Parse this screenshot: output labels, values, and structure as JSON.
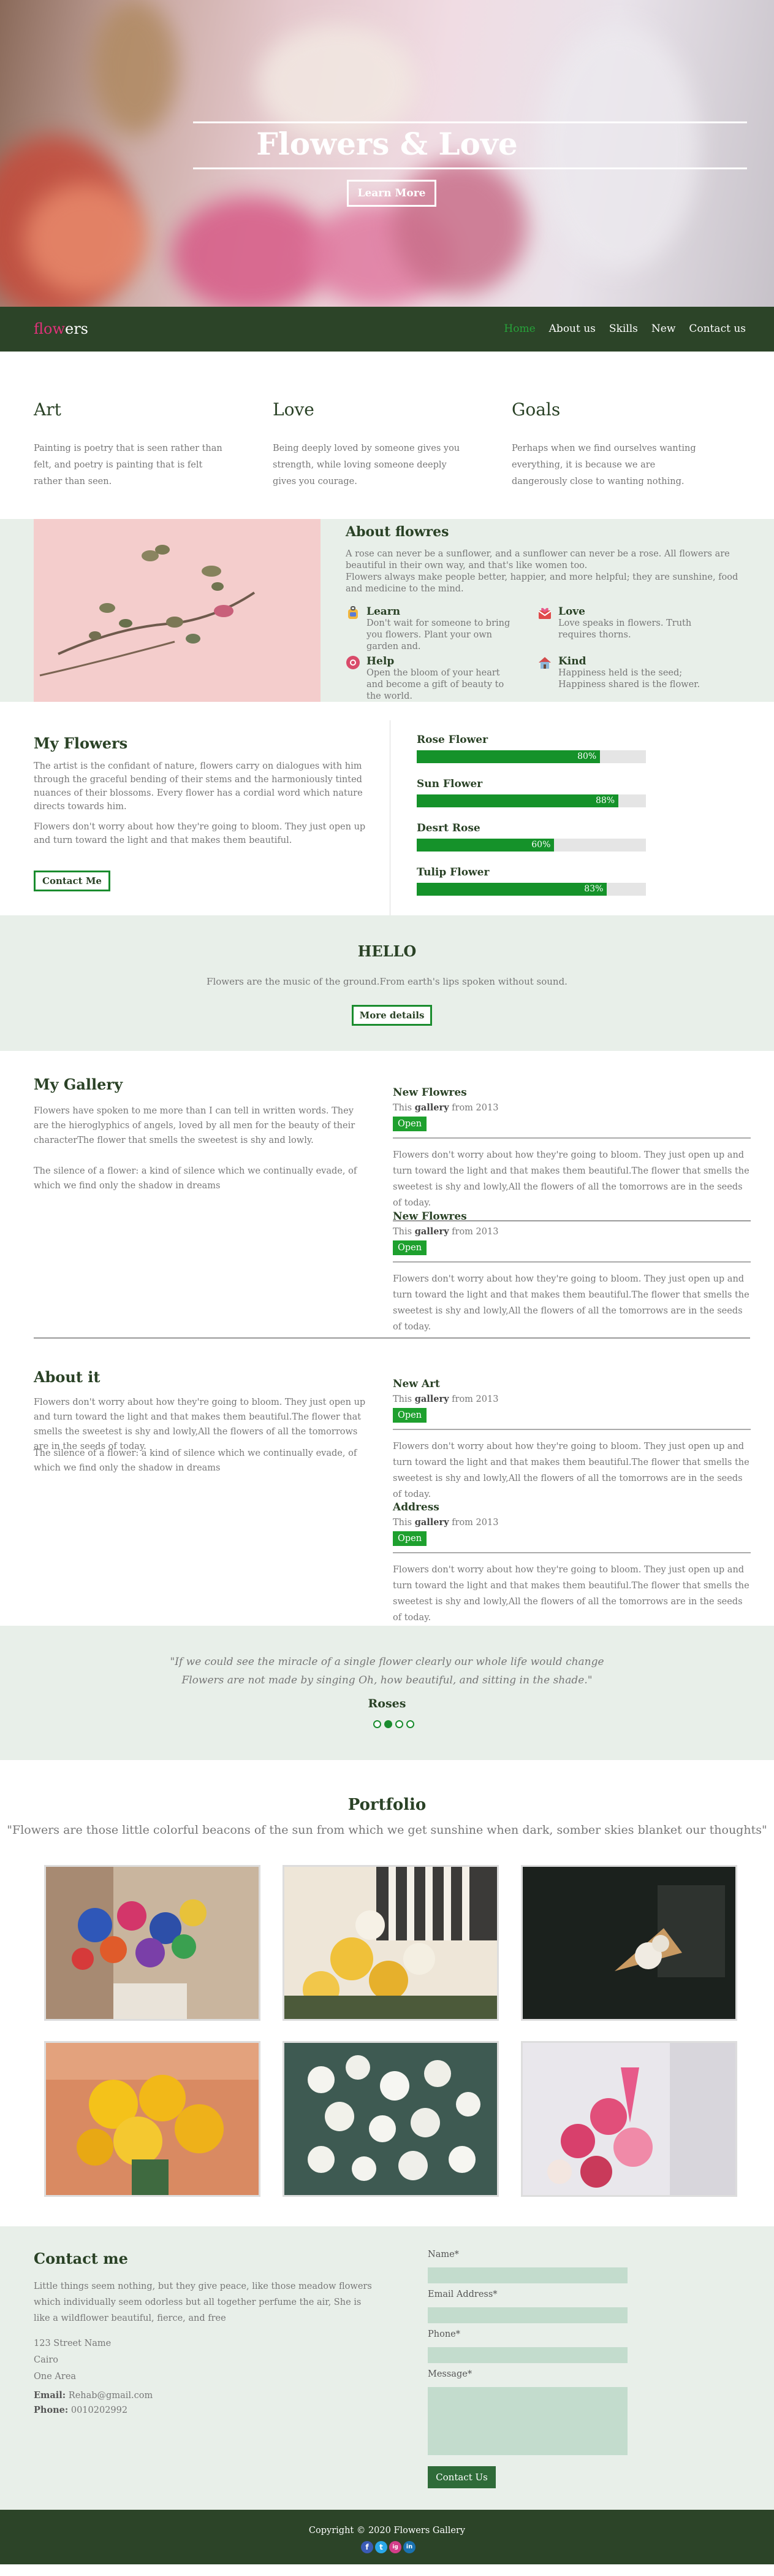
{
  "hero": {
    "title": "Flowers & Love",
    "button": "Learn More"
  },
  "nav": {
    "logo_accent": "flow",
    "logo_rest": "ers",
    "items": [
      "Home",
      "About us",
      "Skills",
      "New",
      "Contact us"
    ]
  },
  "columns": [
    {
      "title": "Art",
      "text": "Painting is poetry that is seen rather than felt, and poetry is painting that is felt rather than seen."
    },
    {
      "title": "Love",
      "text": "Being deeply loved by someone gives you strength, while loving someone deeply gives you courage."
    },
    {
      "title": "Goals",
      "text": "Perhaps when we find ourselves wanting everything, it is because we are dangerously close to wanting nothing."
    }
  ],
  "about": {
    "title": "About flowres",
    "text1": "A rose can never be a sunflower, and a sunflower can never be a rose. All flowers are beautiful in their own way, and that's like women too.",
    "text2": "Flowers always make people better, happier, and more helpful; they are sunshine, food and medicine to the mind.",
    "features": [
      {
        "title": "Learn",
        "text": "Don't wait for someone to bring you flowers. Plant your own garden and.",
        "icon": "backpack-icon"
      },
      {
        "title": "Love",
        "text": "Love speaks in flowers. Truth requires thorns.",
        "icon": "heart-mail-icon"
      },
      {
        "title": "Help",
        "text": "Open the bloom of your heart and become a gift of beauty to the world.",
        "icon": "help-icon"
      },
      {
        "title": "Kind",
        "text": "Happiness held is the seed; Happiness shared is the flower.",
        "icon": "house-icon"
      }
    ]
  },
  "skills": {
    "title": "My Flowers",
    "p1": "The artist is the confidant of nature, flowers carry on dialogues with him through the graceful bending of their stems and the harmoniously tinted nuances of their blossoms. Every flower has a cordial word which nature directs towards him.",
    "p2": "Flowers don't worry about how they're going to bloom. They just open up and turn toward the light and that makes them beautiful.",
    "button": "Contact Me",
    "bars": [
      {
        "name": "Rose Flower",
        "value": 80,
        "label": "80%"
      },
      {
        "name": "Sun Flower",
        "value": 88,
        "label": "88%"
      },
      {
        "name": "Desrt Rose",
        "value": 60,
        "label": "60%"
      },
      {
        "name": "Tulip Flower",
        "value": 83,
        "label": "83%"
      }
    ]
  },
  "hello": {
    "title": "HELLO",
    "text": "Flowers are the music of the ground.From earth's lips spoken without sound.",
    "button": "More details"
  },
  "gallery": {
    "title": "My Gallery",
    "p1": "Flowers have spoken to me more than I can tell in written words. They are the hieroglyphics of angels, loved by all men for the beauty of their characterThe flower that smells the sweetest is shy and lowly.",
    "p2": "The silence of a flower: a kind of silence which we continually evade, of which we find only the shadow in dreams",
    "items": [
      {
        "title": "New Flowres",
        "sub_pre": "This ",
        "sub_bold": "gallery",
        "sub_post": " from 2013",
        "button": "Open",
        "text": "Flowers don't worry about how they're going to bloom. They just open up and turn toward the light and that makes them beautiful.The flower that smells the sweetest is shy and lowly,All the flowers of all the tomorrows are in the seeds of today."
      },
      {
        "title": "New Flowres",
        "sub_pre": "This ",
        "sub_bold": "gallery",
        "sub_post": " from 2013",
        "button": "Open",
        "text": "Flowers don't worry about how they're going to bloom. They just open up and turn toward the light and that makes them beautiful.The flower that smells the sweetest is shy and lowly,All the flowers of all the tomorrows are in the seeds of today."
      }
    ]
  },
  "aboutit": {
    "title": "About it",
    "p1": "Flowers don't worry about how they're going to bloom. They just open up and turn toward the light and that makes them beautiful.The flower that smells the sweetest is shy and lowly,All the flowers of all the tomorrows are in the seeds of today.",
    "p2": "The silence of a flower: a kind of silence which we continually evade, of which we find only the shadow in dreams",
    "items": [
      {
        "title": "New Art",
        "sub_pre": "This ",
        "sub_bold": "gallery",
        "sub_post": " from 2013",
        "button": "Open",
        "text": "Flowers don't worry about how they're going to bloom. They just open up and turn toward the light and that makes them beautiful.The flower that smells the sweetest is shy and lowly,All the flowers of all the tomorrows are in the seeds of today."
      },
      {
        "title": "Address",
        "sub_pre": "This ",
        "sub_bold": "gallery",
        "sub_post": " from 2013",
        "button": "Open",
        "text": "Flowers don't worry about how they're going to bloom. They just open up and turn toward the light and that makes them beautiful.The flower that smells the sweetest is shy and lowly,All the flowers of all the tomorrows are in the seeds of today."
      }
    ]
  },
  "quote": {
    "line1": "\"If we could see the miracle of a single flower clearly our whole life would change",
    "line2": "Flowers are not made by singing Oh, how beautiful, and sitting in the shade.\"",
    "author": "Roses",
    "active_dot": 1
  },
  "portfolio": {
    "title": "Portfolio",
    "quote": "\"Flowers are those little colorful beacons of the sun from which we get sunshine when dark, somber skies blanket our thoughts\""
  },
  "contact": {
    "title": "Contact me",
    "text": "Little things seem nothing, but they give peace, like those meadow flowers which individually seem odorless but all together perfume the air, She is like a wildflower beautiful, fierce, and free",
    "addr1": "123 Street Name",
    "addr2": "Cairo",
    "addr3": "One Area",
    "email_label": "Email:",
    "email": "Rehab@gmail.com",
    "phone_label": "Phone:",
    "phone": "0010202992",
    "form": {
      "name": "Name*",
      "email": "Email Address*",
      "phone": "Phone*",
      "message": "Message*",
      "button": "Contact Us"
    }
  },
  "footer": {
    "copyright": "Copyright © 2020 Flowers Gallery",
    "social": [
      "f",
      "t",
      "ig",
      "in"
    ]
  },
  "colors": {
    "primary": "#2c4428",
    "accent_green": "#15922a",
    "pink": "#e0327a",
    "mint": "#e8efe9"
  }
}
